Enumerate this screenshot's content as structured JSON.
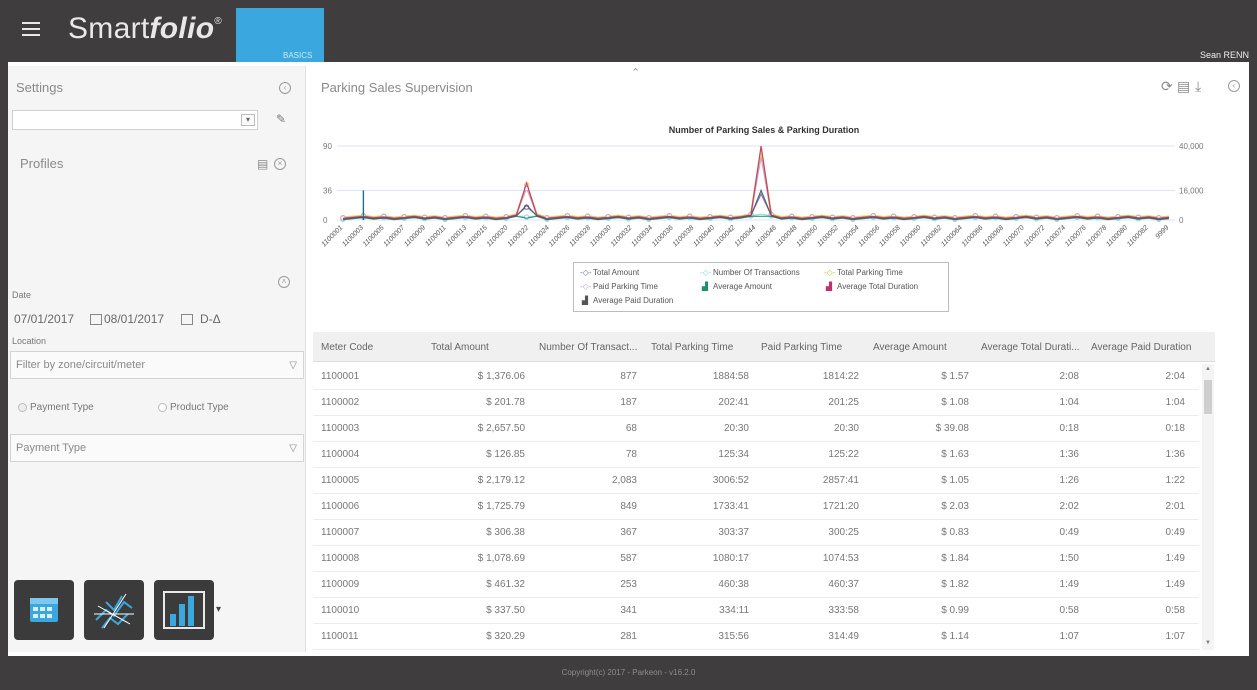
{
  "app": {
    "brand_light": "Smart",
    "brand_bold": "folio",
    "brand_reg": "®",
    "edition": "BASICS",
    "user": "Sean RENN",
    "colors": {
      "topbar": "#403d3e",
      "accent": "#3aa8df"
    }
  },
  "sidebar": {
    "settings_title": "Settings",
    "profiles_title": "Profiles",
    "date_label": "Date",
    "date_from": "07/01/2017",
    "date_to": "08/01/2017",
    "date_mode": "D-Δ",
    "location_label": "Location",
    "location_placeholder": "Filter by zone/circuit/meter",
    "radio_payment": "Payment Type",
    "radio_product": "Product Type",
    "payment_type_placeholder": "Payment Type",
    "nav_icons": [
      "calendar-icon",
      "map-icon",
      "bar-chart-icon"
    ]
  },
  "main": {
    "title": "Parking Sales Supervision",
    "tool_icons": [
      "refresh-icon",
      "print-icon",
      "download-icon"
    ]
  },
  "chart_data": {
    "type": "line",
    "title": "Number of Parking Sales & Parking Duration",
    "y_left_ticks": [
      "90",
      "36",
      "0"
    ],
    "y_right_ticks": [
      "40,000",
      "16,000",
      "0"
    ],
    "x_tick_labels": [
      "1100001",
      "1100003",
      "1100005",
      "1100007",
      "1100009",
      "1100011",
      "1100013",
      "1100015",
      "1100020",
      "1100022",
      "1100024",
      "1100026",
      "1100028",
      "1100030",
      "1100032",
      "1100034",
      "1100036",
      "1100038",
      "1100040",
      "1100042",
      "1100044",
      "1100046",
      "1100048",
      "1100050",
      "1100052",
      "1100054",
      "1100056",
      "1100058",
      "1100060",
      "1100062",
      "1100064",
      "1100066",
      "1100068",
      "1100070",
      "1100072",
      "1100074",
      "1100076",
      "1100078",
      "1100080",
      "1100082",
      "9999"
    ],
    "legend": [
      "Total Amount",
      "Number Of Transactions",
      "Total Parking Time",
      "Paid Parking Time",
      "Average Amount",
      "Average Total Duration",
      "Average Paid Duration"
    ],
    "series_colors": [
      "#6b6bbf",
      "#7fd8e8",
      "#e8d640",
      "#c9a0c9",
      "#1e8e6e",
      "#c0306c",
      "#555555"
    ],
    "peak_categories": [
      "1100022",
      "1100044"
    ],
    "peak_values_left_axis": [
      45,
      90
    ],
    "legend_position": "bottom"
  },
  "table": {
    "columns": [
      "Meter Code",
      "Total Amount",
      "Number Of Transact...",
      "Total Parking Time",
      "Paid Parking Time",
      "Average Amount",
      "Average Total Durati...",
      "Average Paid Duration"
    ],
    "rows": [
      [
        "1100001",
        "$ 1,376.06",
        "877",
        "1884:58",
        "1814:22",
        "$ 1.57",
        "2:08",
        "2:04"
      ],
      [
        "1100002",
        "$ 201.78",
        "187",
        "202:41",
        "201:25",
        "$ 1.08",
        "1:04",
        "1:04"
      ],
      [
        "1100003",
        "$ 2,657.50",
        "68",
        "20:30",
        "20:30",
        "$ 39.08",
        "0:18",
        "0:18"
      ],
      [
        "1100004",
        "$ 126.85",
        "78",
        "125:34",
        "125:22",
        "$ 1.63",
        "1:36",
        "1:36"
      ],
      [
        "1100005",
        "$ 2,179.12",
        "2,083",
        "3006:52",
        "2857:41",
        "$ 1.05",
        "1:26",
        "1:22"
      ],
      [
        "1100006",
        "$ 1,725.79",
        "849",
        "1733:41",
        "1721:20",
        "$ 2.03",
        "2:02",
        "2:01"
      ],
      [
        "1100007",
        "$ 306.38",
        "367",
        "303:37",
        "300:25",
        "$ 0.83",
        "0:49",
        "0:49"
      ],
      [
        "1100008",
        "$ 1,078.69",
        "587",
        "1080:17",
        "1074:53",
        "$ 1.84",
        "1:50",
        "1:49"
      ],
      [
        "1100009",
        "$ 461.32",
        "253",
        "460:38",
        "460:37",
        "$ 1.82",
        "1:49",
        "1:49"
      ],
      [
        "1100010",
        "$ 337.50",
        "341",
        "334:11",
        "333:58",
        "$ 0.99",
        "0:58",
        "0:58"
      ],
      [
        "1100011",
        "$ 320.29",
        "281",
        "315:56",
        "314:49",
        "$ 1.14",
        "1:07",
        "1:07"
      ]
    ]
  },
  "footer": {
    "copyright": "Copyright(c) 2017 - Parkeon - v16.2.0"
  }
}
